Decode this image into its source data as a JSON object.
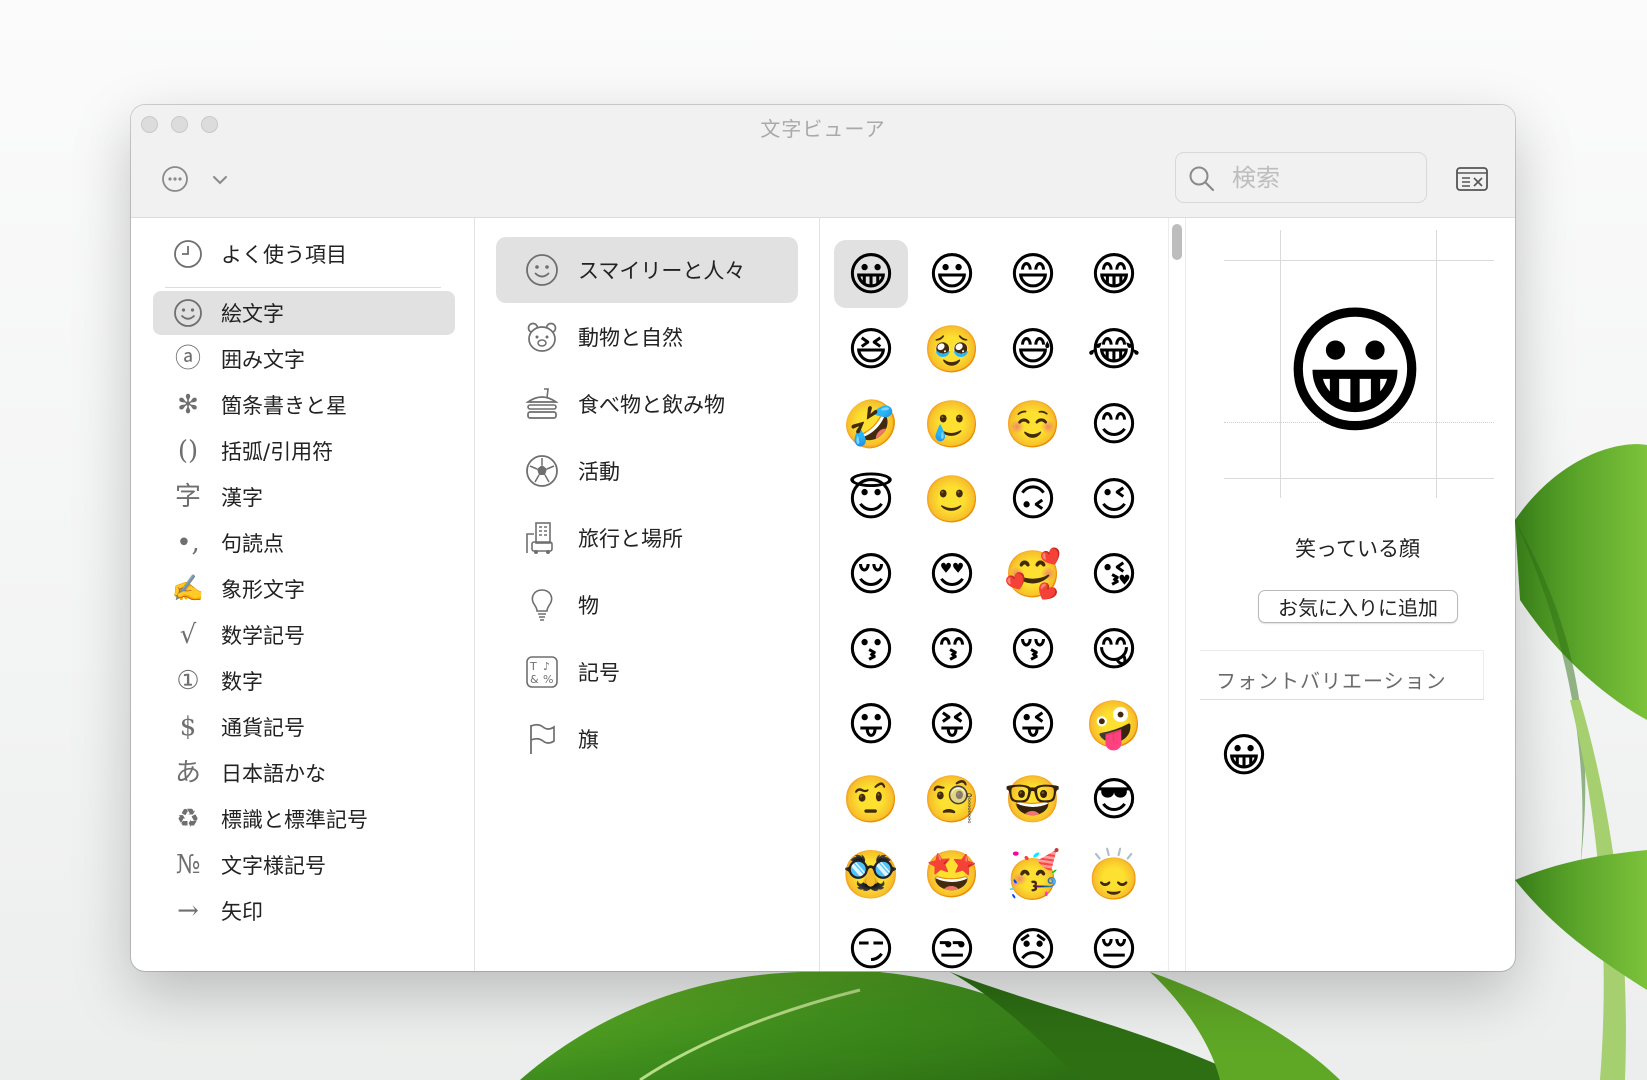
{
  "window": {
    "title": "文字ビューア"
  },
  "search": {
    "placeholder": "検索"
  },
  "sidebar": {
    "items": [
      {
        "label": "よく使う項目",
        "icon": "clock-icon",
        "glyph": ""
      },
      {
        "label": "絵文字",
        "icon": "smiley-icon",
        "glyph": "",
        "selected": true
      },
      {
        "label": "囲み文字",
        "icon": "circled-a-icon",
        "glyph": "ⓐ"
      },
      {
        "label": "箇条書きと星",
        "icon": "asterisk-icon",
        "glyph": "✻"
      },
      {
        "label": "括弧/引用符",
        "icon": "parentheses-icon",
        "glyph": "()"
      },
      {
        "label": "漢字",
        "icon": "kanji-icon",
        "glyph": "字"
      },
      {
        "label": "句読点",
        "icon": "punctuation-icon",
        "glyph": "•,"
      },
      {
        "label": "象形文字",
        "icon": "pictograph-icon",
        "glyph": "✍"
      },
      {
        "label": "数学記号",
        "icon": "square-root-icon",
        "glyph": "√"
      },
      {
        "label": "数字",
        "icon": "circled-one-icon",
        "glyph": "①"
      },
      {
        "label": "通貨記号",
        "icon": "dollar-icon",
        "glyph": "$"
      },
      {
        "label": "日本語かな",
        "icon": "hiragana-a-icon",
        "glyph": "あ"
      },
      {
        "label": "標識と標準記号",
        "icon": "recycle-icon",
        "glyph": "♻"
      },
      {
        "label": "文字様記号",
        "icon": "numero-icon",
        "glyph": "№"
      },
      {
        "label": "矢印",
        "icon": "arrow-right-icon",
        "glyph": "→"
      }
    ]
  },
  "categories": {
    "items": [
      {
        "label": "スマイリーと人々",
        "icon": "smiley-icon",
        "selected": true
      },
      {
        "label": "動物と自然",
        "icon": "bear-icon"
      },
      {
        "label": "食べ物と飲み物",
        "icon": "burger-icon"
      },
      {
        "label": "活動",
        "icon": "soccer-ball-icon"
      },
      {
        "label": "旅行と場所",
        "icon": "building-icon"
      },
      {
        "label": "物",
        "icon": "lightbulb-icon"
      },
      {
        "label": "記号",
        "icon": "symbols-icon"
      },
      {
        "label": "旗",
        "icon": "flag-icon"
      }
    ]
  },
  "emoji_grid": [
    "😀",
    "😃",
    "😄",
    "😁",
    "😆",
    "🥹",
    "😅",
    "😂",
    "🤣",
    "🥲",
    "☺️",
    "😊",
    "😇",
    "🙂",
    "🙃",
    "😉",
    "😌",
    "😍",
    "🥰",
    "😘",
    "😗",
    "😙",
    "😚",
    "😋",
    "😛",
    "😝",
    "😜",
    "🤪",
    "🤨",
    "🧐",
    "🤓",
    "😎",
    "🥸",
    "🤩",
    "🥳",
    "🙂‍↕️",
    "😏",
    "😒",
    "😞",
    "😔"
  ],
  "preview": {
    "glyph": "😀",
    "name": "笑っている顔",
    "favorite_button": "お気に入りに追加",
    "font_variation_header": "フォントバリエーション",
    "font_variations": [
      "😀"
    ]
  }
}
